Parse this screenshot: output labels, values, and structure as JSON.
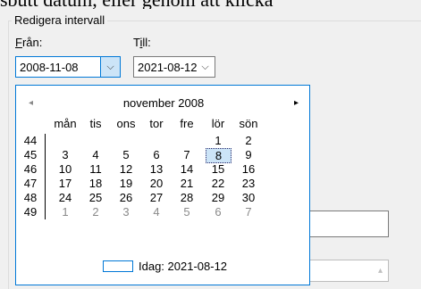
{
  "top_text": "sbutt datum, eller genom att klicka",
  "group": {
    "title": "Redigera intervall"
  },
  "from": {
    "label": "Från:",
    "accel": "F",
    "rest": "rån:",
    "value": "2008-11-08",
    "dropdown": "⌵"
  },
  "to": {
    "label": "Till:",
    "pre": "T",
    "accel": "i",
    "rest": "ll:",
    "value": "2021-08-12",
    "dropdown": "⌵"
  },
  "calendar": {
    "month_title": "november 2008",
    "prev": "◂",
    "next": "▸",
    "weekdays": [
      "mån",
      "tis",
      "ons",
      "tor",
      "fre",
      "lör",
      "sön"
    ],
    "weeks": [
      {
        "week": "44",
        "days": [
          "",
          "",
          "",
          "",
          "",
          "1",
          "2"
        ]
      },
      {
        "week": "45",
        "days": [
          "3",
          "4",
          "5",
          "6",
          "7",
          "8",
          "9"
        ]
      },
      {
        "week": "46",
        "days": [
          "10",
          "11",
          "12",
          "13",
          "14",
          "15",
          "16"
        ]
      },
      {
        "week": "47",
        "days": [
          "17",
          "18",
          "19",
          "20",
          "21",
          "22",
          "23"
        ]
      },
      {
        "week": "48",
        "days": [
          "24",
          "25",
          "26",
          "27",
          "28",
          "29",
          "30"
        ]
      },
      {
        "week": "49",
        "days": [
          "1",
          "2",
          "3",
          "4",
          "5",
          "6",
          "7"
        ]
      }
    ],
    "selected": "8",
    "today_label": "Idag: 2021-08-12"
  },
  "colors": {
    "accent": "#0078d7",
    "selected_bg": "#cce4f7",
    "grey_text": "#8a8a8a"
  }
}
